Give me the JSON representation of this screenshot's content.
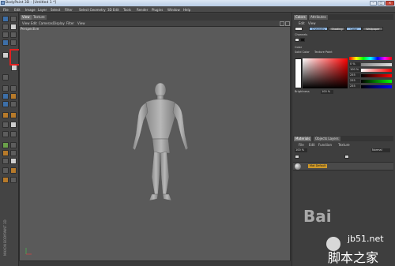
{
  "window": {
    "title": "BodyPaint 3D - [Untitled 1 *]"
  },
  "menu": [
    "File",
    "Edit",
    "Image",
    "Layer",
    "Select",
    "Filter",
    "Select Geometry",
    "3D Edit",
    "Tools",
    "Render",
    "Plugins",
    "Window",
    "Help"
  ],
  "viewport": {
    "tabs": [
      "View",
      "Texture"
    ],
    "menu": [
      "View",
      "Edit",
      "Cameras",
      "Display",
      "Filter",
      "View"
    ],
    "label": "Perspective"
  },
  "right_top": {
    "tabs": [
      "Colors",
      "Attributes"
    ],
    "submenu": [
      "Edit",
      "View"
    ],
    "channel_buttons": [
      "Channels",
      "Shading",
      "Color",
      "Wallpaper"
    ],
    "channels_label": "Channels",
    "color_label": "Color",
    "mode_left": "Solid Color",
    "mode_right": "Texture Paint",
    "sliders": [
      "0 %",
      "100 %",
      "255",
      "255",
      "255"
    ],
    "brightness_label": "Brightness",
    "brightness_value": "100 %"
  },
  "layers": {
    "tabs": [
      "Materials",
      "Objects Layers"
    ],
    "menu": [
      "File",
      "Edit",
      "Function",
      "Texture"
    ],
    "blend_value": "100 %",
    "mode": "Normal",
    "layer_name": "Mat Default"
  },
  "brand": "MAXON BODYPAINT 3D",
  "watermarks": {
    "bai": "Bai",
    "site": "jb51.net",
    "cn": "脚本之家"
  }
}
